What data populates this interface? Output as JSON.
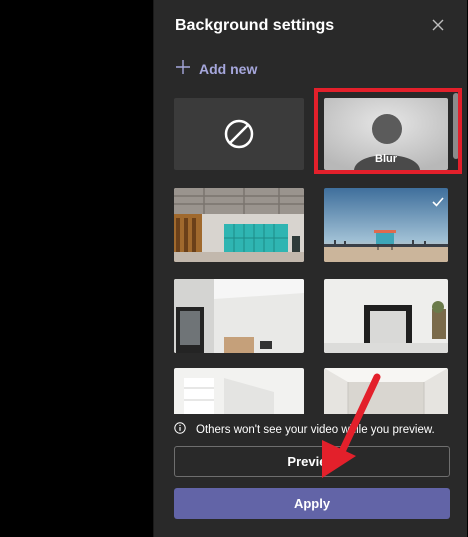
{
  "panel": {
    "title": "Background settings",
    "add_new_label": "Add new",
    "tiles": [
      {
        "name": "none"
      },
      {
        "name": "blur",
        "label": "Blur"
      },
      {
        "name": "office-lockers"
      },
      {
        "name": "beach-lifeguard",
        "selected": true
      },
      {
        "name": "white-room-window"
      },
      {
        "name": "white-room-mirror"
      },
      {
        "name": "white-loft"
      },
      {
        "name": "white-room-light"
      }
    ],
    "notice": "Others won't see your video while you preview.",
    "preview_label": "Preview",
    "apply_label": "Apply"
  },
  "colors": {
    "panel_bg": "#292929",
    "accent": "#6264a7",
    "accent_text": "#a6a7dc",
    "annotation": "#e3202b"
  }
}
